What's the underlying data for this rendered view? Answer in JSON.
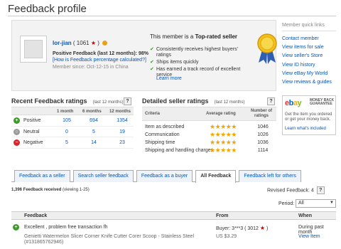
{
  "page_title": "Feedback profile",
  "profile": {
    "username": "lor-jian",
    "score": "( 1061",
    "score_close": ")",
    "positive_feedback": "Positive Feedback (last 12 months): 98%",
    "how_link": "[How is Feedback percentage calculated?]",
    "member_since": "Member since: Oct-12-15 in China",
    "top_rated_prefix": "This member is a ",
    "top_rated_bold": "Top-rated seller",
    "bullets": [
      "Consistently receives highest buyers' ratings",
      "Ships items quickly",
      "Has earned a track record of excellent service"
    ],
    "learn_more": "Learn more"
  },
  "quick_links": {
    "title": "Member quick links",
    "items": [
      "Contact member",
      "View items for sale",
      "View seller's Store",
      "View ID history",
      "View eBay My World",
      "View reviews & guides"
    ]
  },
  "ad": {
    "logo_letters": [
      "e",
      "b",
      "a",
      "y"
    ],
    "logo_colors": [
      "#e53238",
      "#0064d2",
      "#f5af02",
      "#86b817"
    ],
    "badge_lines": [
      "MONEY BACK",
      "GUARANTEE"
    ],
    "text": "Get the item you ordered or get your money back.",
    "link": "Learn what's included"
  },
  "recent_ratings": {
    "title": "Recent Feedback ratings",
    "subtitle": "(last 12 months)",
    "help": "?",
    "columns": [
      "1 month",
      "6 months",
      "12 months"
    ],
    "rows": [
      {
        "label": "Positive",
        "symbol": "+",
        "color": "#3a9d23",
        "values": [
          "105",
          "694",
          "1354"
        ]
      },
      {
        "label": "Neutral",
        "symbol": "○",
        "color": "#9a9a9a",
        "values": [
          "0",
          "5",
          "19"
        ]
      },
      {
        "label": "Negative",
        "symbol": "−",
        "color": "#d9262c",
        "values": [
          "5",
          "14",
          "23"
        ]
      }
    ]
  },
  "detailed_ratings": {
    "title": "Detailed seller ratings",
    "subtitle": "(last 12 months)",
    "help": "?",
    "col_criteria": "Criteria",
    "col_avg": "Average rating",
    "col_count_1": "Number of",
    "col_count_2": "ratings",
    "rows": [
      {
        "criteria": "Item as described",
        "stars": "★★★★★",
        "count": "1046"
      },
      {
        "criteria": "Communication",
        "stars": "★★★★★",
        "count": "1026"
      },
      {
        "criteria": "Shipping time",
        "stars": "★★★★★",
        "count": "1036"
      },
      {
        "criteria": "Shipping and handling charges",
        "stars": "★★★★★",
        "count": "1114"
      }
    ]
  },
  "tabs": [
    {
      "label": "Feedback as a seller",
      "active": false
    },
    {
      "label": "Search seller feedback",
      "active": false
    },
    {
      "label": "Feedback as a buyer",
      "active": false
    },
    {
      "label": "All Feedback",
      "active": true
    },
    {
      "label": "Feedback left for others",
      "active": false
    }
  ],
  "feedback_list": {
    "count_bold": "1,396 Feedback received",
    "count_view": " (viewing 1-25)",
    "revised": "Revised Feedback: 4",
    "help": "?",
    "period_label": "Period:",
    "period_value": "All",
    "col_feedback": "Feedback",
    "col_from": "From",
    "col_when": "When",
    "entries": [
      {
        "comment": "Excellent , problem free transaction fh",
        "item": "Genietti Watermelon Slicer Corner Knife Cutter Corer Scoop - Stainless Steel (#131865762946)",
        "buyer": "Buyer: 3***3 ( 3012",
        "buyer_close": ")",
        "price": "US $3.29",
        "when": "During past month",
        "view": "View Item"
      }
    ]
  }
}
